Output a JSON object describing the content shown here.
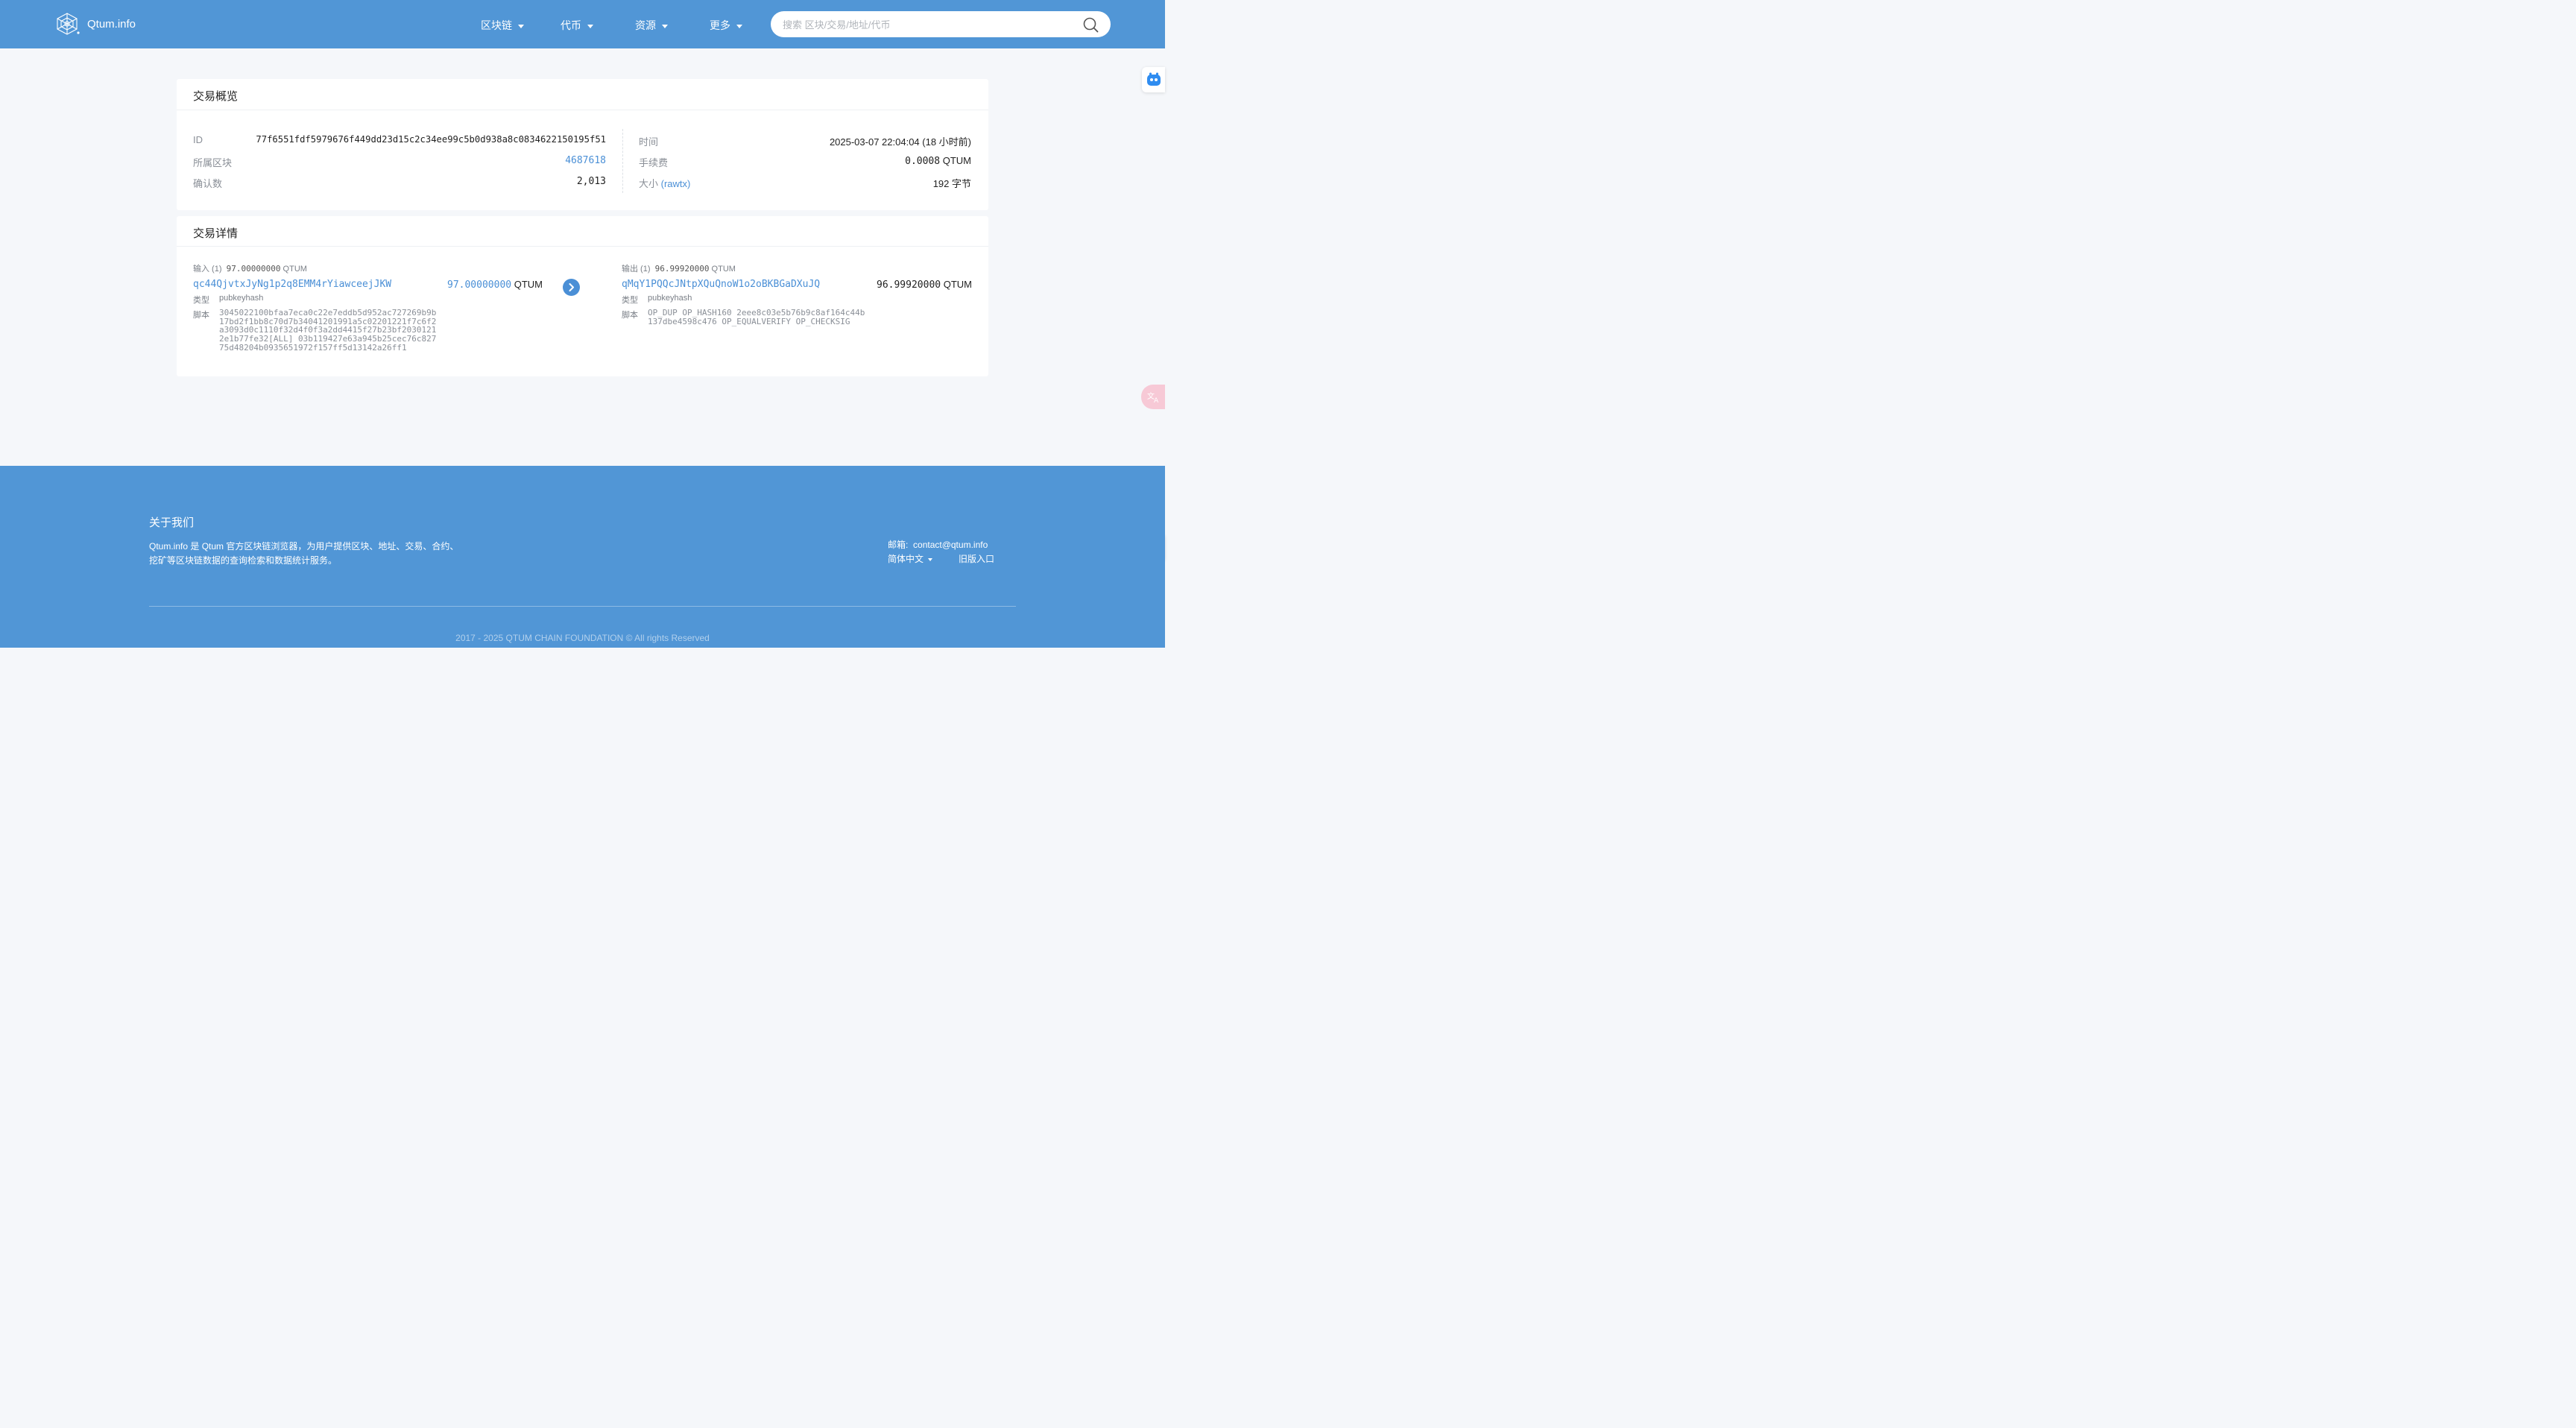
{
  "header": {
    "brand": "Qtum.info",
    "nav": [
      {
        "label": "区块链"
      },
      {
        "label": "代币"
      },
      {
        "label": "资源"
      },
      {
        "label": "更多"
      }
    ],
    "search_placeholder": "搜索 区块/交易/地址/代币"
  },
  "overview": {
    "title": "交易概览",
    "id_label": "ID",
    "id_value": "77f6551fdf5979676f449dd23d15c2c34ee99c5b0d938a8c0834622150195f51",
    "block_label": "所属区块",
    "block_value": "4687618",
    "confirm_label": "确认数",
    "confirm_value": "2,013",
    "time_label": "时间",
    "time_value": "2025-03-07 22:04:04 (18 小时前)",
    "fee_label": "手续费",
    "fee_value": "0.0008",
    "fee_unit": "QTUM",
    "size_label": "大小",
    "size_link": "(rawtx)",
    "size_value": "192 字节"
  },
  "detail": {
    "title": "交易详情",
    "input": {
      "header": "输入 (1)",
      "header_amount": "97.00000000",
      "unit": "QTUM",
      "address": "qc44QjvtxJyNg1p2q8EMM4rYiawceejJKW",
      "amount": "97.00000000",
      "type_label": "类型",
      "type_value": "pubkeyhash",
      "script_label": "脚本",
      "script_value": "3045022100bfaa7eca0c22e7eddb5d952ac727269b9b17bd2f1bb8c70d7b34041201991a5c02201221f7c6f2a3093d0c1110f32d4f0f3a2dd4415f27b23bf20301212e1b77fe32[ALL] 03b119427e63a945b25cec76c82775d48204b0935651972f157ff5d13142a26ff1"
    },
    "output": {
      "header": "输出 (1)",
      "header_amount": "96.99920000",
      "unit": "QTUM",
      "address": "qMqY1PQQcJNtpXQuQnoW1o2oBKBGaDXuJQ",
      "amount": "96.99920000",
      "type_label": "类型",
      "type_value": "pubkeyhash",
      "script_label": "脚本",
      "script_value": "OP_DUP OP_HASH160 2eee8c03e5b76b9c8af164c44b137dbe4598c476 OP_EQUALVERIFY OP_CHECKSIG"
    }
  },
  "footer": {
    "about_title": "关于我们",
    "about_desc": "Qtum.info 是 Qtum 官方区块链浏览器，为用户提供区块、地址、交易、合约、挖矿等区块链数据的查询检索和数据统计服务。",
    "email_label": "邮箱:",
    "email_value": "contact@qtum.info",
    "language": "简体中文",
    "legacy_link": "旧版入口",
    "copyright": "2017 - 2025 QTUM CHAIN FOUNDATION © All rights Reserved"
  },
  "colors": {
    "brand": "#5196d6",
    "link": "#4a8fd6"
  }
}
